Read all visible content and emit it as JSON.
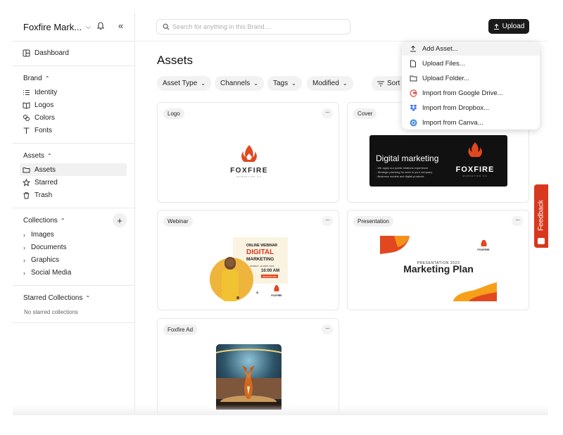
{
  "sidebar": {
    "brand_name": "Foxfire Mark...",
    "nav_dashboard": "Dashboard",
    "brand_section": "Brand",
    "brand_items": [
      "Identity",
      "Logos",
      "Colors",
      "Fonts"
    ],
    "assets_section": "Assets",
    "assets_items": [
      "Assets",
      "Starred",
      "Trash"
    ],
    "collections_section": "Collections",
    "collections_items": [
      "Images",
      "Documents",
      "Graphics",
      "Social Media"
    ],
    "starred_collections_section": "Starred Collections",
    "no_starred": "No starred collections"
  },
  "topbar": {
    "search_placeholder": "Search for anything in this Brand....",
    "upload_label": "Upload"
  },
  "main": {
    "title": "Assets",
    "filters": [
      "Asset Type",
      "Channels",
      "Tags",
      "Modified"
    ],
    "sort_label": "Sort b"
  },
  "cards": [
    {
      "tag": "Logo"
    },
    {
      "tag": "Cover"
    },
    {
      "tag": "Webinar"
    },
    {
      "tag": "Presentation"
    },
    {
      "tag": "Foxfire Ad"
    }
  ],
  "thumbs": {
    "logo_word": "FOXFIRE",
    "logo_sub": "MARKETING CO",
    "cover_title": "Digital marketing",
    "cover_lines": [
      "- We apply our public relations experience",
      "- Strategic planning for work in your company",
      "- Business models and digital products"
    ],
    "cover_brand": "FOXFIRE",
    "cover_brand_sub": "MARKETING CO",
    "webinar_kicker": "ONLINE WEBINAR",
    "webinar_title_1": "DIGITAL",
    "webinar_title_2": "MARKETING",
    "webinar_date": "MONDAY, 16 APRIL 2023",
    "webinar_time": "10:00 AM",
    "webinar_btn": "REGISTER NOW",
    "webinar_brand": "FOXFIRE",
    "pres_kicker": "PRESENTATION 2023",
    "pres_title": "Marketing Plan",
    "pres_brand": "FOXFIRE"
  },
  "upload_menu": {
    "items": [
      "Add Asset...",
      "Upload Files...",
      "Upload Folder...",
      "Import from Google Drive...",
      "Import from Dropbox...",
      "Import from Canva..."
    ],
    "icons": [
      "upload-icon",
      "file-icon",
      "folder-icon",
      "google-drive-icon",
      "dropbox-icon",
      "canva-icon"
    ]
  },
  "feedback_label": "Feedback",
  "colors": {
    "accent": "#d8381e",
    "primary_button": "#1a1a1a",
    "foxfire_orange": "#e2481f"
  }
}
